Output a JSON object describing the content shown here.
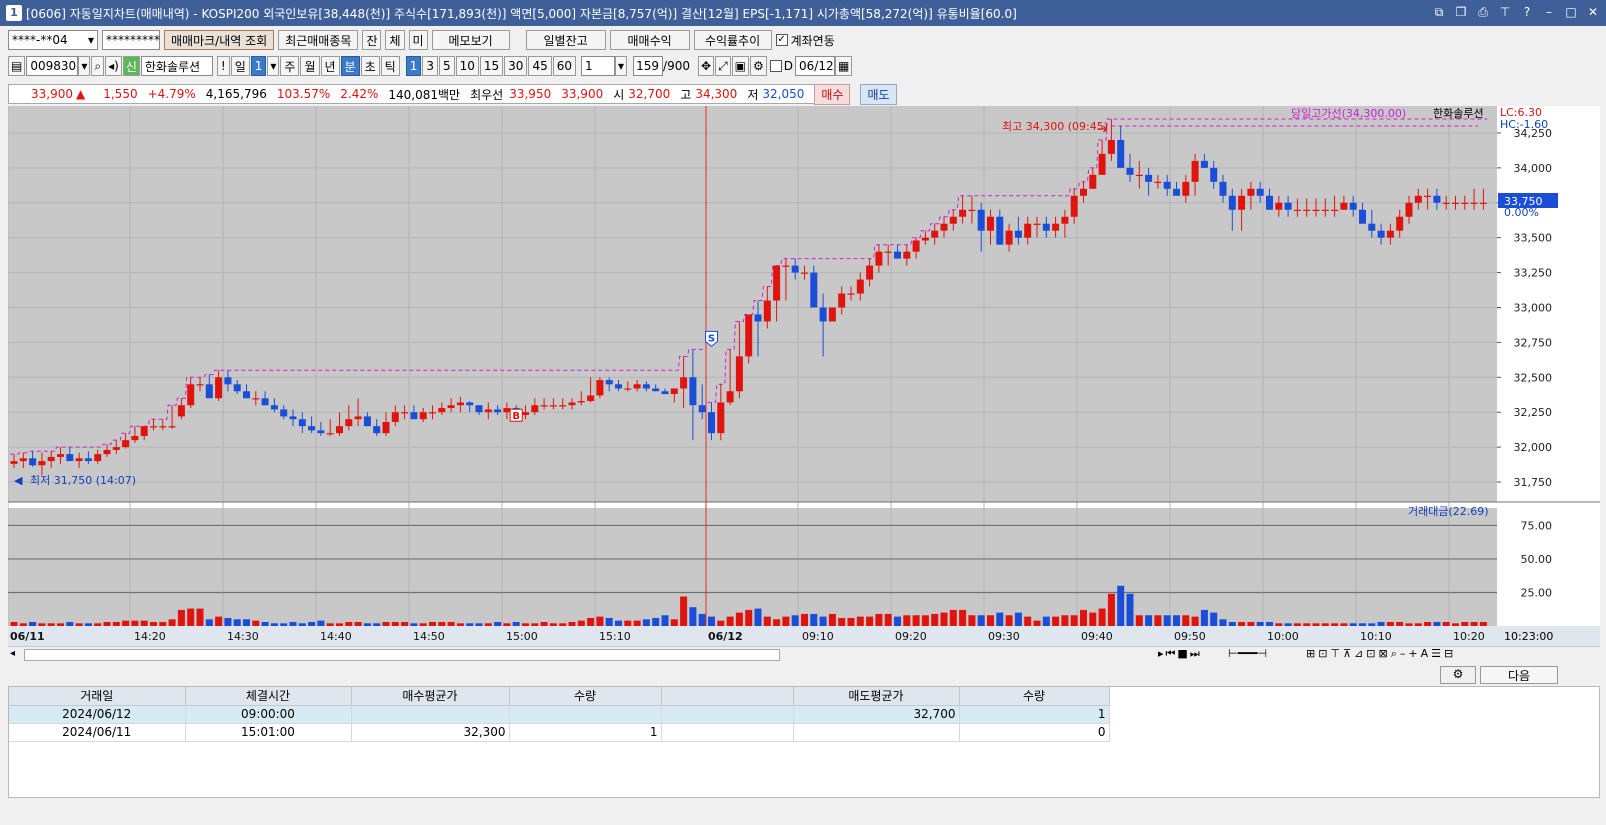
{
  "window": {
    "num": "1",
    "title": "[0606] 자동일지차트(매매내역) - KOSPI200 외국인보유[38,448(천)] 주식수[171,893(천)] 액면[5,000] 자본금[8,757(억)] 결산[12월] EPS[-1,171] 시가총액[58,272(억)] 유통비율[60.0]"
  },
  "toolbar1": {
    "account": "****-**04",
    "password": "*********",
    "btn_mark": "매매마크/내역 조회",
    "btn_recent": "최근매매종목",
    "btn_jan": "잔",
    "btn_che": "체",
    "btn_mi": "미",
    "btn_memo": "메모보기",
    "btn_daily": "일별잔고",
    "btn_profit": "매매수익",
    "btn_rate": "수익률추이",
    "check_link": "계좌연동"
  },
  "toolbar2": {
    "code": "009830",
    "name": "한화솔루션",
    "excl": "!",
    "il": "일",
    "il_val": "1",
    "ju": "주",
    "wol": "월",
    "nyeon": "년",
    "bun": "분",
    "cho": "초",
    "tik": "틱",
    "intervals": [
      "1",
      "3",
      "5",
      "10",
      "15",
      "30",
      "45",
      "60"
    ],
    "interval_sel": "1",
    "count": "159",
    "count_total": "/900",
    "d_label": "D",
    "date": "06/12"
  },
  "quote": {
    "price": "33,900",
    "arrow": "▲",
    "change": "1,550",
    "rate": "+4.79%",
    "volume": "4,165,796",
    "vol_ratio": "103.57%",
    "turnover": "2.42%",
    "amount": "140,081백만",
    "best_label": "최우선",
    "ask": "33,950",
    "bid": "33,900",
    "open_label": "시",
    "open": "32,700",
    "high_label": "고",
    "high": "34,300",
    "low_label": "저",
    "low": "32,050",
    "buy": "매수",
    "sell": "매도"
  },
  "chart": {
    "legend_line": "당일고가선(34,300.00)",
    "legend_name": "한화솔루션",
    "lc": "LC:6.30",
    "hc": "HC:-1.60",
    "high_note": "최고 34,300 (09:45)",
    "low_note": "최저 31,750 (14:07)",
    "current": "33,750",
    "current_pct": "0.00%",
    "sub_legend": "거래대금(22.69)",
    "price_ticks": [
      "34,250",
      "34,000",
      "33,750",
      "33,500",
      "33,250",
      "33,000",
      "32,750",
      "32,500",
      "32,250",
      "32,000",
      "31,750"
    ],
    "vol_ticks": [
      "75.00",
      "50.00",
      "25.00"
    ],
    "time_labels": [
      "06/11",
      "14:20",
      "14:30",
      "14:40",
      "14:50",
      "15:00",
      "15:10",
      "06/12",
      "09:10",
      "09:20",
      "09:30",
      "09:40",
      "09:50",
      "10:00",
      "10:10",
      "10:20"
    ],
    "time_right": "10:23:00",
    "marker_s": "S",
    "marker_b": "B",
    "colors": {
      "up": "#e0140f",
      "down": "#1a4ed8",
      "high_line": "#d020d0",
      "cursor": "#e03020"
    }
  },
  "chart_data": {
    "type": "candlestick",
    "open": [
      31880,
      31900,
      31920,
      31870,
      31900,
      31930,
      31950,
      31900,
      31920,
      31900,
      31950,
      31980,
      32000,
      32050,
      32080,
      32150,
      32150,
      32150,
      32220,
      32300,
      32450,
      32450,
      32350,
      32500,
      32450,
      32400,
      32350,
      32350,
      32300,
      32270,
      32220,
      32200,
      32150,
      32120,
      32100,
      32100,
      32150,
      32200,
      32220,
      32150,
      32100,
      32180,
      32250,
      32250,
      32200,
      32250,
      32250,
      32280,
      32300,
      32320,
      32300,
      32250,
      32270,
      32250,
      32280,
      32230,
      32250,
      32300,
      32300,
      32300,
      32300,
      32320,
      32330,
      32370,
      32480,
      32450,
      32420,
      32420,
      32450,
      32420,
      32400,
      32380,
      32420,
      32500,
      32300,
      32250,
      32100,
      32320,
      32400,
      32650,
      32950,
      32900,
      33050,
      33300,
      33300,
      33250,
      33250,
      33000,
      32900,
      33000,
      33100,
      33100,
      33200,
      33300,
      33400,
      33400,
      33350,
      33400,
      33480,
      33500,
      33550,
      33600,
      33650,
      33700,
      33700,
      33550,
      33650,
      33450,
      33550,
      33500,
      33600,
      33600,
      33550,
      33600,
      33650,
      33800,
      33850,
      33950,
      34100,
      34200,
      34000,
      33950,
      33950,
      33900,
      33900,
      33850,
      33800,
      33900,
      34050,
      34000,
      33900,
      33800,
      33700,
      33800,
      33850,
      33800,
      33700,
      33750,
      33700,
      33700,
      33700,
      33700,
      33700,
      33700,
      33750,
      33700,
      33600,
      33550,
      33500,
      33550,
      33650,
      33750,
      33800,
      33800,
      33750,
      33750,
      33750,
      33750,
      33750
    ],
    "high": [
      31950,
      31960,
      31970,
      31960,
      31970,
      32000,
      32000,
      31960,
      31970,
      31980,
      32020,
      32050,
      32100,
      32150,
      32150,
      32200,
      32200,
      32300,
      32350,
      32500,
      32500,
      32520,
      32550,
      32550,
      32480,
      32450,
      32400,
      32400,
      32350,
      32300,
      32270,
      32250,
      32220,
      32180,
      32200,
      32250,
      32300,
      32350,
      32250,
      32200,
      32250,
      32300,
      32300,
      32300,
      32280,
      32300,
      32320,
      32350,
      32360,
      32330,
      32300,
      32320,
      32300,
      32320,
      32300,
      32300,
      32350,
      32350,
      32350,
      32350,
      32350,
      32400,
      32500,
      32500,
      32500,
      32480,
      32470,
      32480,
      32470,
      32450,
      32420,
      32400,
      32650,
      32700,
      32450,
      32320,
      32450,
      32700,
      32900,
      32950,
      33050,
      33150,
      33300,
      33350,
      33350,
      33300,
      33300,
      33100,
      33000,
      33150,
      33150,
      33250,
      33350,
      33450,
      33450,
      33450,
      33450,
      33500,
      33550,
      33600,
      33650,
      33700,
      33800,
      33800,
      33750,
      33700,
      33700,
      33600,
      33650,
      33650,
      33650,
      33650,
      33650,
      33700,
      33850,
      33900,
      34000,
      34200,
      34350,
      34300,
      34100,
      34050,
      34000,
      33950,
      33950,
      33900,
      33950,
      34100,
      34100,
      34050,
      33950,
      33850,
      33850,
      33900,
      33900,
      33850,
      33800,
      33800,
      33780,
      33780,
      33780,
      33780,
      33800,
      33800,
      33800,
      33750,
      33700,
      33600,
      33600,
      33700,
      33800,
      33850,
      33850,
      33850,
      33800,
      33800,
      33800,
      33850,
      33850
    ],
    "low": [
      31850,
      31850,
      31860,
      31800,
      31850,
      31880,
      31900,
      31850,
      31880,
      31880,
      31930,
      31950,
      31990,
      32030,
      32050,
      32120,
      32120,
      32130,
      32200,
      32280,
      32400,
      32380,
      32330,
      32400,
      32380,
      32350,
      32300,
      32300,
      32250,
      32200,
      32150,
      32100,
      32100,
      32080,
      32080,
      32080,
      32120,
      32150,
      32150,
      32080,
      32080,
      32150,
      32200,
      32200,
      32180,
      32200,
      32230,
      32250,
      32250,
      32250,
      32230,
      32200,
      32230,
      32200,
      32230,
      32200,
      32230,
      32270,
      32270,
      32270,
      32270,
      32300,
      32320,
      32350,
      32400,
      32400,
      32400,
      32400,
      32400,
      32400,
      32380,
      32320,
      32280,
      32050,
      32200,
      32050,
      32050,
      32300,
      32350,
      32600,
      32650,
      32850,
      32900,
      33050,
      33200,
      33200,
      33000,
      32650,
      32900,
      32950,
      33050,
      33050,
      33150,
      33250,
      33300,
      33350,
      33300,
      33350,
      33450,
      33450,
      33500,
      33550,
      33600,
      33600,
      33400,
      33450,
      33450,
      33400,
      33450,
      33450,
      33500,
      33500,
      33500,
      33500,
      33600,
      33750,
      33850,
      33950,
      34050,
      34000,
      33900,
      33850,
      33800,
      33850,
      33800,
      33800,
      33750,
      33800,
      34000,
      33850,
      33750,
      33550,
      33550,
      33700,
      33750,
      33700,
      33650,
      33650,
      33650,
      33650,
      33650,
      33650,
      33650,
      33700,
      33650,
      33600,
      33500,
      33450,
      33450,
      33500,
      33600,
      33700,
      33700,
      33700,
      33700,
      33700,
      33700,
      33700,
      33700
    ],
    "close": [
      31900,
      31920,
      31870,
      31900,
      31930,
      31950,
      31900,
      31920,
      31900,
      31950,
      31980,
      32000,
      32050,
      32080,
      32150,
      32150,
      32150,
      32150,
      32300,
      32450,
      32450,
      32350,
      32500,
      32450,
      32400,
      32350,
      32350,
      32300,
      32270,
      32220,
      32200,
      32150,
      32120,
      32100,
      32100,
      32150,
      32200,
      32220,
      32150,
      32100,
      32180,
      32250,
      32250,
      32200,
      32250,
      32250,
      32280,
      32300,
      32320,
      32300,
      32250,
      32270,
      32250,
      32280,
      32230,
      32250,
      32300,
      32300,
      32300,
      32300,
      32320,
      32330,
      32370,
      32480,
      32450,
      32420,
      32420,
      32450,
      32420,
      32400,
      32380,
      32420,
      32500,
      32300,
      32250,
      32100,
      32320,
      32400,
      32650,
      32950,
      32900,
      33050,
      33300,
      33300,
      33250,
      33250,
      33000,
      32900,
      33000,
      33100,
      33100,
      33200,
      33300,
      33400,
      33400,
      33350,
      33400,
      33480,
      33500,
      33550,
      33600,
      33650,
      33700,
      33700,
      33550,
      33650,
      33450,
      33550,
      33500,
      33600,
      33600,
      33550,
      33600,
      33650,
      33800,
      33850,
      33950,
      34100,
      34200,
      34000,
      33950,
      33950,
      33900,
      33900,
      33850,
      33800,
      33900,
      34050,
      34000,
      33900,
      33800,
      33700,
      33800,
      33850,
      33800,
      33700,
      33750,
      33700,
      33700,
      33700,
      33700,
      33700,
      33700,
      33750,
      33700,
      33600,
      33550,
      33500,
      33550,
      33650,
      33750,
      33800,
      33800,
      33750,
      33750,
      33750,
      33750,
      33750,
      33750
    ],
    "volume": [
      3,
      2,
      3,
      2,
      2,
      2,
      3,
      2,
      2,
      2,
      3,
      3,
      4,
      4,
      4,
      3,
      3,
      5,
      12,
      13,
      13,
      5,
      7,
      6,
      5,
      5,
      4,
      3,
      2,
      2,
      3,
      2,
      3,
      4,
      2,
      2,
      3,
      3,
      2,
      2,
      3,
      3,
      3,
      2,
      2,
      3,
      3,
      3,
      2,
      2,
      2,
      2,
      3,
      2,
      3,
      2,
      2,
      3,
      2,
      2,
      3,
      4,
      6,
      7,
      6,
      4,
      4,
      4,
      5,
      6,
      8,
      5,
      22,
      14,
      9,
      7,
      4,
      7,
      10,
      12,
      13,
      7,
      5,
      7,
      8,
      9,
      9,
      7,
      9,
      6,
      6,
      7,
      7,
      9,
      9,
      7,
      8,
      8,
      8,
      9,
      10,
      12,
      12,
      8,
      8,
      8,
      10,
      8,
      10,
      7,
      4,
      7,
      7,
      8,
      8,
      12,
      10,
      13,
      24,
      30,
      24,
      8,
      8,
      8,
      8,
      8,
      8,
      7,
      12,
      10,
      5,
      3,
      3,
      3,
      3,
      3,
      2,
      2,
      2,
      2,
      2,
      2,
      2,
      2,
      2,
      2,
      2,
      3,
      3,
      3,
      2,
      2,
      3,
      3,
      3,
      2,
      3,
      3,
      3
    ],
    "price_range": [
      31650,
      34400
    ],
    "volume_range": [
      0,
      88
    ],
    "day_high_line": 34300,
    "prior_day_high_line": 32600
  },
  "table": {
    "headers": [
      "거래일",
      "체결시간",
      "매수평균가",
      "수량",
      "",
      "매도평균가",
      "수량"
    ],
    "rows": [
      [
        "2024/06/12",
        "09:00:00",
        "",
        "",
        "",
        "32,700",
        "1"
      ],
      [
        "2024/06/11",
        "15:01:00",
        "32,300",
        "1",
        "",
        "",
        "0"
      ]
    ],
    "next_button": "다음"
  }
}
